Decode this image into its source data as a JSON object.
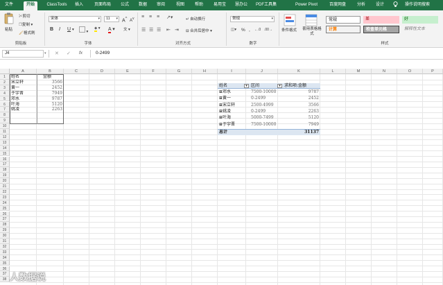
{
  "tabs": [
    "文件",
    "开始",
    "ClassTools",
    "插入",
    "页面布局",
    "公式",
    "数据",
    "审阅",
    "视图",
    "帮助",
    "易用宝",
    "慧办公",
    "PDF工具集",
    "Power Pivot",
    "百度网盘",
    "分析",
    "设计",
    "操作说明搜索"
  ],
  "ribbon": {
    "paste": "粘贴",
    "cut": "剪切",
    "copy": "复制",
    "format_painter": "格式刷",
    "clipboard_group": "剪贴板",
    "font_name": "宋体",
    "font_size": "11",
    "bold": "B",
    "italic": "I",
    "underline": "U",
    "font_group": "字体",
    "wrap_text": "自动换行",
    "merge_center": "合并后居中",
    "align_group": "对齐方式",
    "number_format": "常规",
    "number_group": "数字",
    "cond_format": "条件格式",
    "table_format": "套用表格格式",
    "styles": {
      "normal": "常规",
      "bad": "差",
      "good": "好",
      "calc": "计算",
      "check": "检查单元格",
      "explain": "解释性文本"
    },
    "styles_group": "样式"
  },
  "formula_bar": {
    "name_box": "J4",
    "fx": "fx",
    "value": "0-2499"
  },
  "columns": [
    "A",
    "B",
    "C",
    "D",
    "E",
    "F",
    "G",
    "H",
    "I",
    "J",
    "K",
    "L",
    "M",
    "N",
    "O",
    "P"
  ],
  "rows": [
    "1",
    "2",
    "3",
    "4",
    "5",
    "6",
    "7",
    "8",
    "9",
    "10",
    "11",
    "12",
    "13",
    "14",
    "15",
    "16",
    "17",
    "18",
    "19",
    "20",
    "21",
    "22",
    "23",
    "24",
    "25",
    "26",
    "27",
    "28",
    "29",
    "30",
    "31",
    "32",
    "33",
    "34",
    "35",
    "36",
    "37",
    "38"
  ],
  "source_table": {
    "headers": [
      "姓名",
      "金额"
    ],
    "rows": [
      [
        "宋立轩",
        "3566"
      ],
      [
        "黄一",
        "2452"
      ],
      [
        "于宇晋",
        "7949"
      ],
      [
        "邓水",
        "9787"
      ],
      [
        "叶海",
        "5120"
      ],
      [
        "姚凌",
        "2263"
      ]
    ]
  },
  "pivot": {
    "headers": [
      "姓名",
      "区间",
      "求和项:金额"
    ],
    "rows": [
      [
        "⊞邓水",
        "7500-10000",
        "9787"
      ],
      [
        "⊞黄一",
        "0-2499",
        "2452"
      ],
      [
        "⊞宋立轩",
        "2500-4999",
        "3566"
      ],
      [
        "⊞姚凌",
        "0-2499",
        "2263"
      ],
      [
        "⊞叶海",
        "5000-7499",
        "5120"
      ],
      [
        "⊞于宇晋",
        "7500-10000",
        "7949"
      ]
    ],
    "total_label": "总计",
    "total_value": "31137"
  },
  "watermark": "人数据说"
}
